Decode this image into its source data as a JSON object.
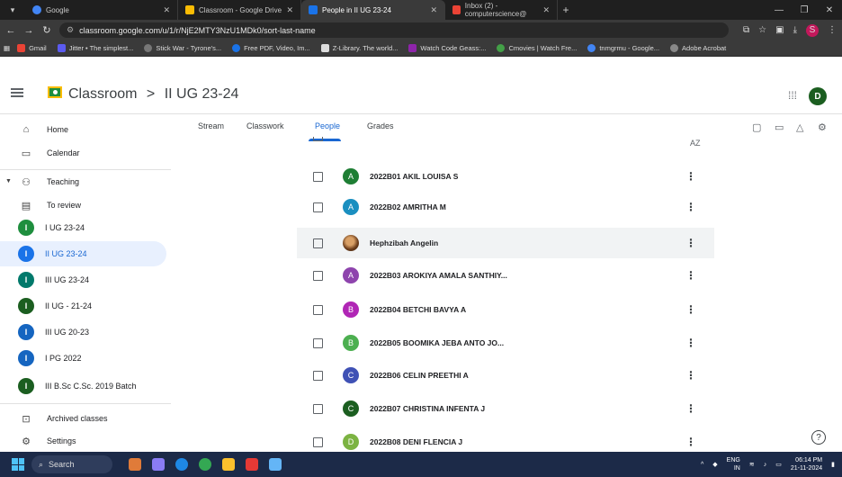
{
  "browser": {
    "tabs": [
      {
        "label": "Google",
        "color": "#4285f4",
        "active": false
      },
      {
        "label": "Classroom - Google Drive",
        "color": "#fbbc04",
        "active": false
      },
      {
        "label": "People in II UG 23-24",
        "color": "#1e8e3e",
        "active": true
      },
      {
        "label": "Inbox (2) - computerscience@",
        "color": "#ea4335",
        "active": false
      }
    ],
    "url": "classroom.google.com/u/1/r/NjE2MTY3NzU1MDk0/sort-last-name",
    "profile_initial": "S",
    "bookmarks": [
      {
        "label": "Gmail",
        "color": "#ea4335"
      },
      {
        "label": "Jitter • The simplest...",
        "color": "#5b5bf0"
      },
      {
        "label": "Stick War - Tyrone's...",
        "color": "#777777"
      },
      {
        "label": "Free PDF, Video, Im...",
        "color": "#1a73e8"
      },
      {
        "label": "Z-Library. The world...",
        "color": "#dddddd"
      },
      {
        "label": "Watch Code Geass:...",
        "color": "#8e24aa"
      },
      {
        "label": "Cmovies | Watch Fre...",
        "color": "#43a047"
      },
      {
        "label": "tnmgrmu - Google...",
        "color": "#4285f4"
      },
      {
        "label": "Adobe Acrobat",
        "color": "#888888"
      }
    ]
  },
  "app": {
    "name": "Classroom",
    "separator": ">",
    "class_name": "II UG 23-24",
    "user_initial": "D"
  },
  "sidebar": {
    "home": "Home",
    "calendar": "Calendar",
    "teaching": "Teaching",
    "to_review": "To review",
    "classes": [
      {
        "label": "I UG 23-24",
        "color": "#1e8e3e"
      },
      {
        "label": "II UG 23-24",
        "color": "#1a73e8"
      },
      {
        "label": "III UG 23-24",
        "color": "#00796b"
      },
      {
        "label": "II UG - 21-24",
        "color": "#1b5e20"
      },
      {
        "label": "III UG 20-23",
        "color": "#1565c0"
      },
      {
        "label": "I PG 2022",
        "color": "#1565c0"
      },
      {
        "label": "III B.Sc C.Sc. 2019 Batch",
        "color": "#1b5e20"
      }
    ],
    "archived": "Archived classes",
    "settings": "Settings"
  },
  "tabs": {
    "stream": "Stream",
    "classwork": "Classwork",
    "people": "People",
    "grades": "Grades"
  },
  "people": [
    {
      "initial": "A",
      "name": "2022B01 AKIL LOUISA S",
      "color": "#1e7e34"
    },
    {
      "initial": "A",
      "name": "2022B02 AMRITHA M",
      "color": "#1a8fc0"
    },
    {
      "initial": "",
      "name": "Hephzibah Angelin",
      "color": "photo"
    },
    {
      "initial": "A",
      "name": "2022B03 AROKIYA AMALA SANTHIY...",
      "color": "#8e44ad"
    },
    {
      "initial": "B",
      "name": "2022B04 BETCHI BAVYA A",
      "color": "#b026b5"
    },
    {
      "initial": "B",
      "name": "2022B05 BOOMIKA JEBA ANTO JO...",
      "color": "#4caf50"
    },
    {
      "initial": "C",
      "name": "2022B06 CELIN PREETHI A",
      "color": "#3f51b5"
    },
    {
      "initial": "C",
      "name": "2022B07 CHRISTINA INFENTA J",
      "color": "#1b5e20"
    },
    {
      "initial": "D",
      "name": "2022B08 DENI FLENCIA J",
      "color": "#7cb342"
    }
  ],
  "taskbar": {
    "search": "Search",
    "lang_top": "ENG",
    "lang_bottom": "IN",
    "time": "06:14 PM",
    "date": "21-11-2024"
  }
}
